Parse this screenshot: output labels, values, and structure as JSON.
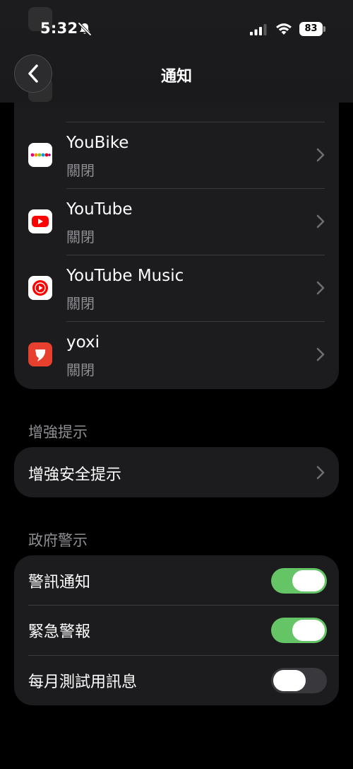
{
  "status_bar": {
    "time": "5:32",
    "battery": "83"
  },
  "nav": {
    "title": "通知"
  },
  "apps": [
    {
      "name": "YouBike",
      "status": "關閉",
      "icon": "youbike-icon"
    },
    {
      "name": "YouTube",
      "status": "關閉",
      "icon": "youtube-icon"
    },
    {
      "name": "YouTube Music",
      "status": "關閉",
      "icon": "youtube-music-icon"
    },
    {
      "name": "yoxi",
      "status": "關閉",
      "icon": "yoxi-icon"
    }
  ],
  "enhanced": {
    "header": "增強提示",
    "item": "增強安全提示"
  },
  "government": {
    "header": "政府警示",
    "items": [
      {
        "label": "警訊通知",
        "on": true
      },
      {
        "label": "緊急警報",
        "on": true
      },
      {
        "label": "每月測試用訊息",
        "on": false
      }
    ]
  },
  "colors": {
    "toggle_on": "#65c466",
    "toggle_off": "#39393d",
    "youtube_red": "#ff0000",
    "yoxi_red": "#e8402f"
  }
}
